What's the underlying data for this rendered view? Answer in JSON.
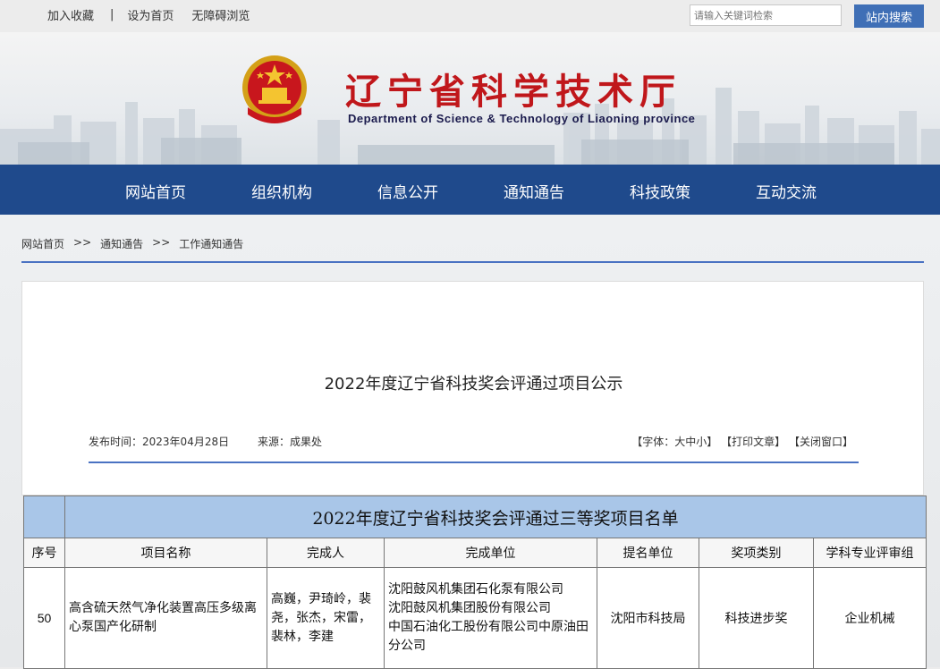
{
  "topbar": {
    "links": [
      "加入收藏",
      "设为首页",
      "无障碍浏览"
    ],
    "divider": "|",
    "search_placeholder": "请输入关键词检索",
    "search_button": "站内搜索"
  },
  "header": {
    "title_cn": "辽宁省科学技术厅",
    "title_en": "Department of Science & Technology of Liaoning province"
  },
  "nav": {
    "items": [
      "网站首页",
      "组织机构",
      "信息公开",
      "通知通告",
      "科技政策",
      "互动交流"
    ]
  },
  "breadcrumb": {
    "items": [
      "网站首页",
      "通知通告",
      "工作通知通告"
    ],
    "separator": ">>"
  },
  "article": {
    "title": "2022年度辽宁省科技奖会评通过项目公示",
    "publish_label": "发布时间：",
    "publish_date": "2023年04月28日",
    "source_label": "来源：",
    "source": "成果处",
    "tools": {
      "font": "【字体：大中小】",
      "print": "【打印文章】",
      "close": "【关闭窗口】"
    }
  },
  "table": {
    "caption": "2022年度辽宁省科技奖会评通过三等奖项目名单",
    "headers": [
      "序号",
      "项目名称",
      "完成人",
      "完成单位",
      "提名单位",
      "奖项类别",
      "学科专业评审组"
    ],
    "rows": [
      {
        "no": "50",
        "project": "高含硫天然气净化装置高压多级离心泵国产化研制",
        "people": "高巍，尹琦岭，裴尧，张杰，宋雷，裴林，李建",
        "units": [
          "沈阳鼓风机集团石化泵有限公司",
          "沈阳鼓风机集团股份有限公司",
          "中国石油化工股份有限公司中原油田分公司"
        ],
        "nominator": "沈阳市科技局",
        "category": "科技进步奖",
        "group": "企业机械"
      }
    ]
  },
  "colors": {
    "nav_bg": "#1f4a8c",
    "title_red": "#c0171b",
    "search_button_bg": "#3f6fb6",
    "table_header_bg": "#a9c6e8",
    "divider_blue": "#4a72c2"
  }
}
